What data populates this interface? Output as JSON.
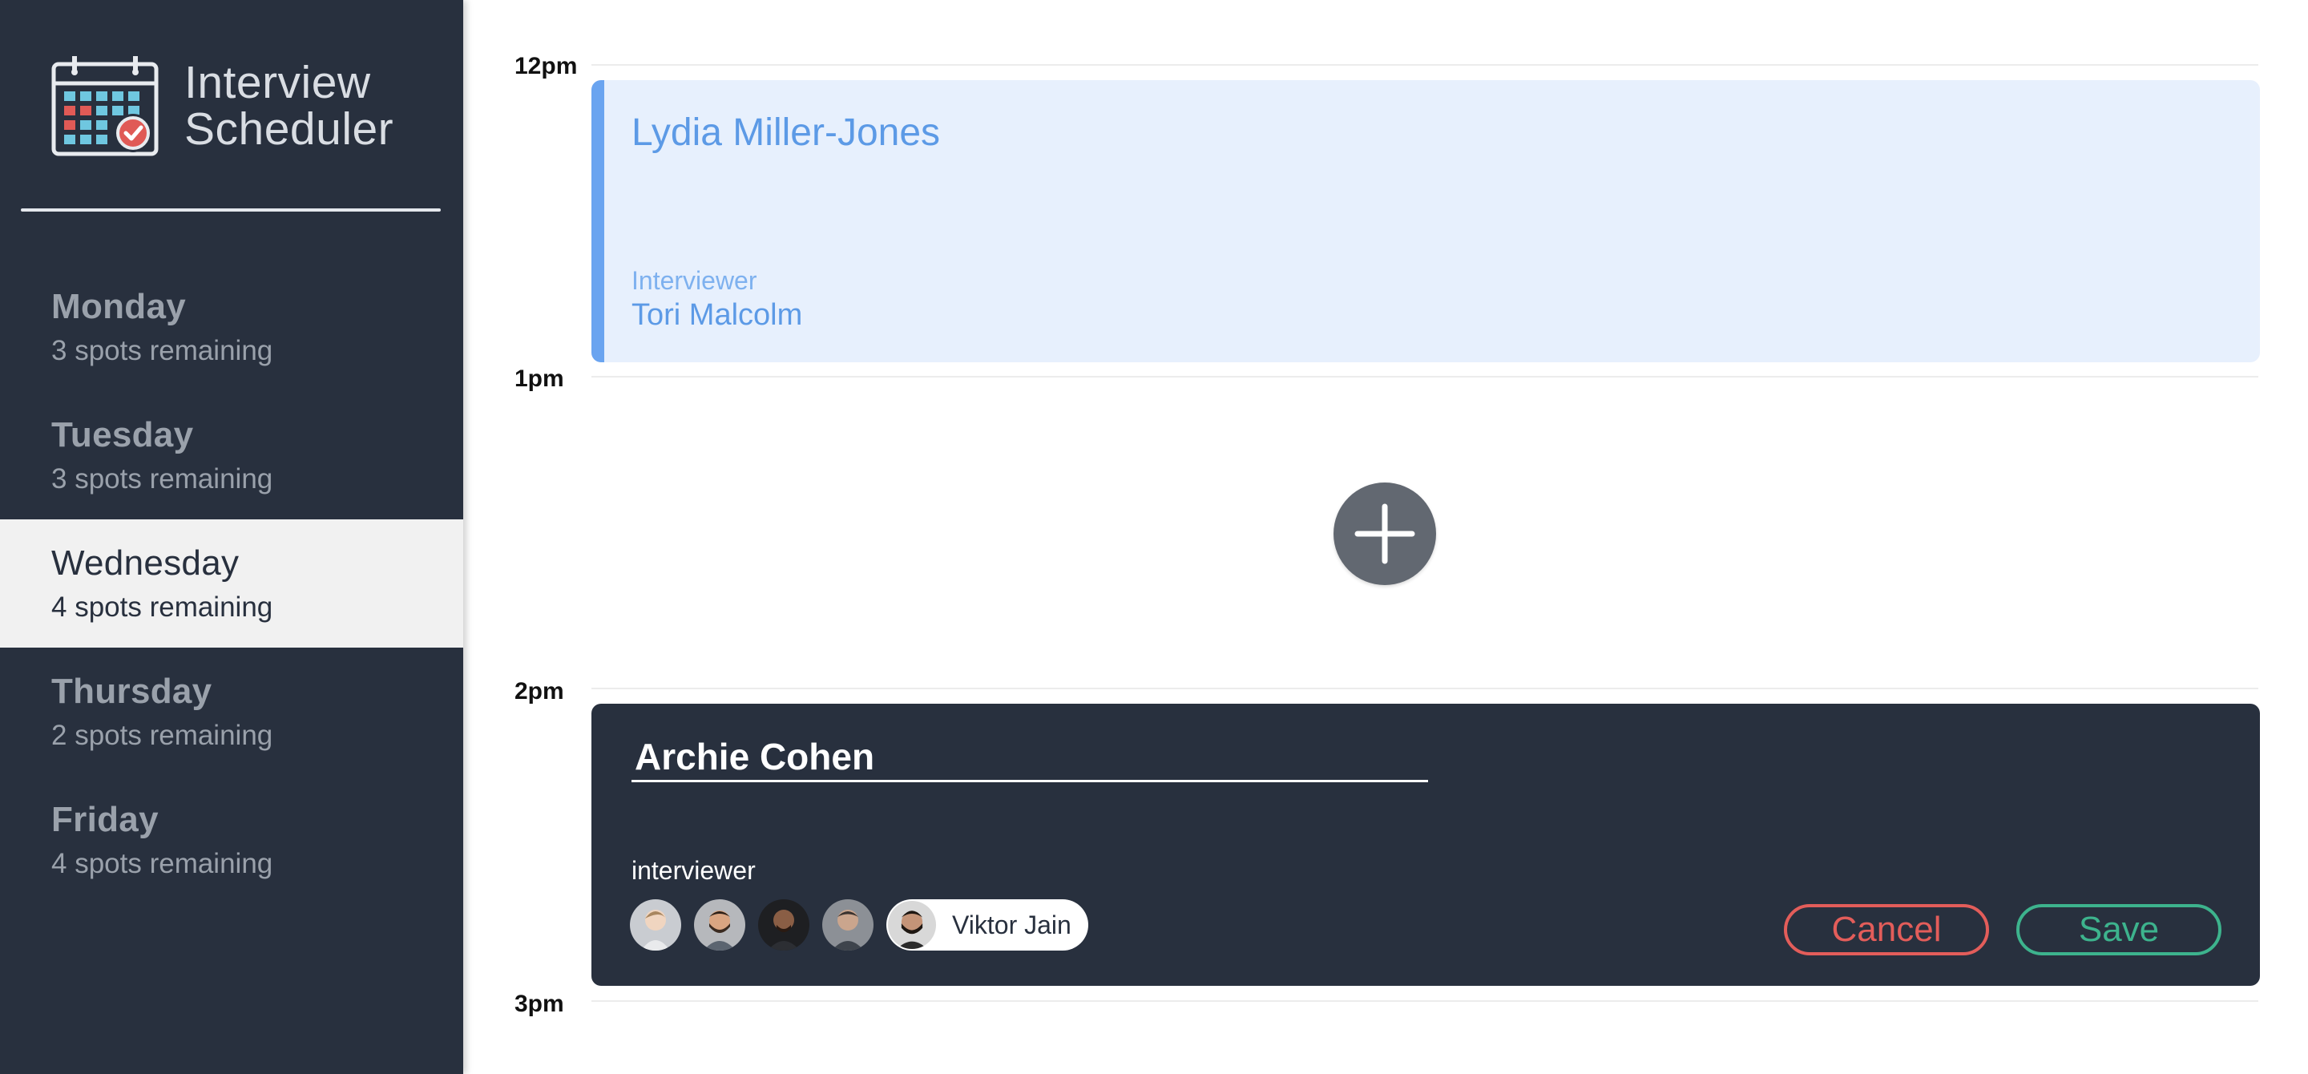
{
  "sidebar": {
    "brand": {
      "line1": "Interview",
      "line2": "Scheduler",
      "logo_icon": "calendar-check-icon"
    },
    "days": [
      {
        "name": "Monday",
        "spots": "3 spots remaining",
        "selected": false
      },
      {
        "name": "Tuesday",
        "spots": "3 spots remaining",
        "selected": false
      },
      {
        "name": "Wednesday",
        "spots": "4 spots remaining",
        "selected": true
      },
      {
        "name": "Thursday",
        "spots": "2 spots remaining",
        "selected": false
      },
      {
        "name": "Friday",
        "spots": "4 spots remaining",
        "selected": false
      }
    ]
  },
  "schedule": {
    "hours": [
      "12pm",
      "1pm",
      "2pm",
      "3pm"
    ],
    "appointment": {
      "student": "Lydia Miller-Jones",
      "interviewer_label": "Interviewer",
      "interviewer": "Tori Malcolm"
    },
    "add_icon": "plus-icon",
    "form": {
      "student_value": "Archie Cohen",
      "interviewer_label": "interviewer",
      "interviewers": [
        "avatar-1",
        "avatar-2",
        "avatar-3",
        "avatar-4"
      ],
      "selected_interviewer": "Viktor Jain",
      "cancel_label": "Cancel",
      "save_label": "Save"
    }
  },
  "colors": {
    "sidebar_bg": "#28303e",
    "selected_day_bg": "#f1f1f1",
    "appointment_bg": "#e7f0fd",
    "appointment_accent": "#6aa4f0",
    "cancel": "#e35d5a",
    "save": "#3db38d"
  }
}
